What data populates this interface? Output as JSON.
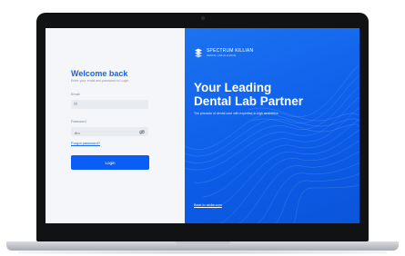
{
  "login": {
    "title": "Welcome back",
    "subtitle": "Enter your email and password to Login",
    "email_label": "Email",
    "email_value": "",
    "email_icon": "mail-icon",
    "password_label": "Password",
    "password_value": "8ro",
    "password_icon": "eye-slash-icon",
    "forgot_label": "Forgot password?",
    "login_button": "Login"
  },
  "brand": {
    "name": "SPECTRUM KILLIAN",
    "tagline": "DENTAL LAB ALLIANCE",
    "headline_line1": "Your Leading",
    "headline_line2": "Dental Lab Partner",
    "description": "The pinnacle of dental care with expertise in high aesthetics",
    "back_link": "Back to skdla.com"
  },
  "colors": {
    "accent": "#0b5ef5",
    "panel_blue": "#0c5ce9",
    "heading_blue": "#1565e8",
    "form_bg": "#f4f6fa",
    "input_bg": "#e8ebf0"
  }
}
